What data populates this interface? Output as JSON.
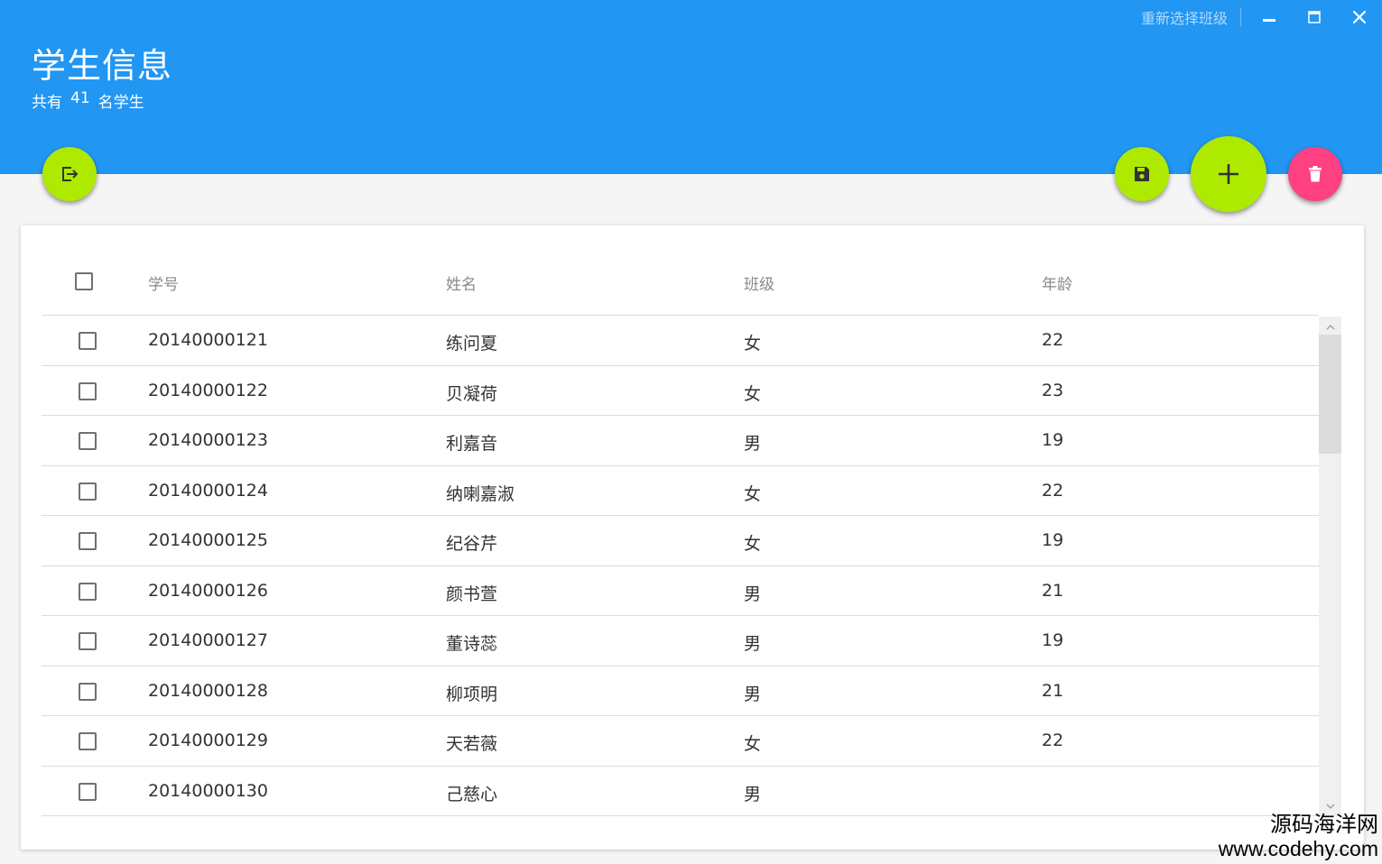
{
  "header": {
    "title": "学生信息",
    "subtitle_prefix": "共有",
    "student_count": "41",
    "subtitle_suffix": "名学生"
  },
  "window": {
    "reselect_class_label": "重新选择班级",
    "minimize_icon": "minimize-icon",
    "maximize_icon": "maximize-icon",
    "close_icon": "close-icon"
  },
  "actions": {
    "exit_icon": "exit-icon",
    "save_icon": "save-icon",
    "add_icon": "plus-icon",
    "delete_icon": "trash-icon"
  },
  "colors": {
    "header_bg": "#2196f3",
    "fab_green": "#aeea00",
    "fab_pink": "#ff4081"
  },
  "table": {
    "columns": [
      "学号",
      "姓名",
      "班级",
      "年龄"
    ],
    "rows": [
      {
        "id": "20140000121",
        "name": "练问夏",
        "class": "女",
        "age": "22"
      },
      {
        "id": "20140000122",
        "name": "贝凝荷",
        "class": "女",
        "age": "23"
      },
      {
        "id": "20140000123",
        "name": "利嘉音",
        "class": "男",
        "age": "19"
      },
      {
        "id": "20140000124",
        "name": "纳喇嘉淑",
        "class": "女",
        "age": "22"
      },
      {
        "id": "20140000125",
        "name": "纪谷芹",
        "class": "女",
        "age": "19"
      },
      {
        "id": "20140000126",
        "name": "颜书萱",
        "class": "男",
        "age": "21"
      },
      {
        "id": "20140000127",
        "name": "董诗蕊",
        "class": "男",
        "age": "19"
      },
      {
        "id": "20140000128",
        "name": "柳项明",
        "class": "男",
        "age": "21"
      },
      {
        "id": "20140000129",
        "name": "天若薇",
        "class": "女",
        "age": "22"
      },
      {
        "id": "20140000130",
        "name": "己慈心",
        "class": "男",
        "age": ""
      }
    ]
  },
  "watermark": {
    "line1": "源码海洋网",
    "line2": "www.codehy.com"
  }
}
